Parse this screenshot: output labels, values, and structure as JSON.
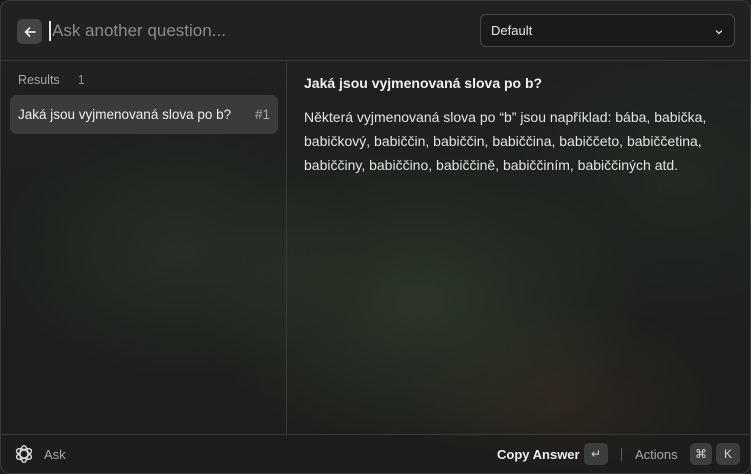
{
  "header": {
    "back_icon": "arrow-left-icon",
    "search_placeholder": "Ask another question...",
    "search_value": "",
    "model_select": {
      "selected": "Default",
      "icon": "chevron-down-icon"
    }
  },
  "results": {
    "label": "Results",
    "count": "1",
    "items": [
      {
        "title": "Jaká jsou vyjmenovaná slova po b?",
        "number": "#1"
      }
    ]
  },
  "detail": {
    "question": "Jaká jsou vyjmenovaná slova po b?",
    "answer": "Některá vyjmenovaná slova po “b” jsou například: bába, babička, babičkový, babiččin, babiččin, babiččina, babiččeto, babiččetina, babiččiny, babiččino, babiččině, babiččiním, babiččiných atd."
  },
  "footer": {
    "logo_icon": "openai-logo-icon",
    "ask_label": "Ask",
    "copy_answer_label": "Copy Answer",
    "enter_key": "↵",
    "actions_label": "Actions",
    "cmd_key": "⌘",
    "k_key": "K"
  },
  "colors": {
    "background": "#1c1d1c",
    "selected_item": "#3a3c39",
    "key_badge": "#3c3e3b",
    "text_primary": "#e7e7e5",
    "text_secondary": "#a7a8a5"
  }
}
